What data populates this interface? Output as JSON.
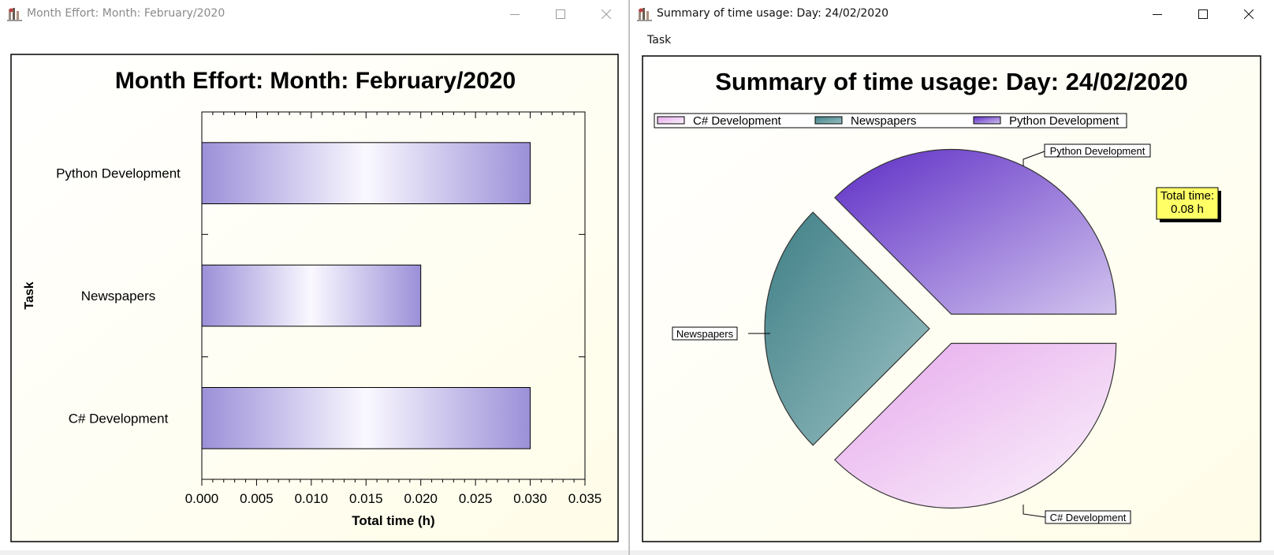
{
  "left_window": {
    "title": "Month Effort: Month: February/2020",
    "chart": {
      "title": "Month Effort: Month: February/2020",
      "ylabel": "Task",
      "xlabel": "Total time (h)",
      "tick_labels": [
        "0.000",
        "0.005",
        "0.010",
        "0.015",
        "0.020",
        "0.025",
        "0.030",
        "0.035"
      ]
    }
  },
  "right_window": {
    "title": "Summary of time usage: Day: 24/02/2020",
    "menu": {
      "task_label": "Task"
    },
    "chart": {
      "title": "Summary of time usage: Day: 24/02/2020",
      "legend": [
        "C# Development",
        "Newspapers",
        "Python Development"
      ],
      "slice_labels": [
        "C# Development",
        "Newspapers",
        "Python Development"
      ],
      "total_time_label": "Total time:",
      "total_time_value": "0.08 h"
    }
  },
  "colors": {
    "bar_dark": "#9b90d8",
    "bar_light": "#faf8ff",
    "pie_csharp": "#e6a8ec",
    "pie_newspapers": "#4a8a92",
    "pie_python": "#6a3ac8",
    "total_box": "#ffff66",
    "chart_bg": "#fffde8"
  },
  "chart_data": [
    {
      "type": "bar",
      "orientation": "horizontal",
      "title": "Month Effort: Month: February/2020",
      "xlabel": "Total time (h)",
      "ylabel": "Task",
      "categories": [
        "Python Development",
        "Newspapers",
        "C# Development"
      ],
      "values": [
        0.03,
        0.02,
        0.03
      ],
      "xlim": [
        0,
        0.035
      ]
    },
    {
      "type": "pie",
      "title": "Summary of time usage: Day: 24/02/2020",
      "categories": [
        "C# Development",
        "Newspapers",
        "Python Development"
      ],
      "values": [
        0.03,
        0.02,
        0.03
      ],
      "legend": "top"
    }
  ]
}
